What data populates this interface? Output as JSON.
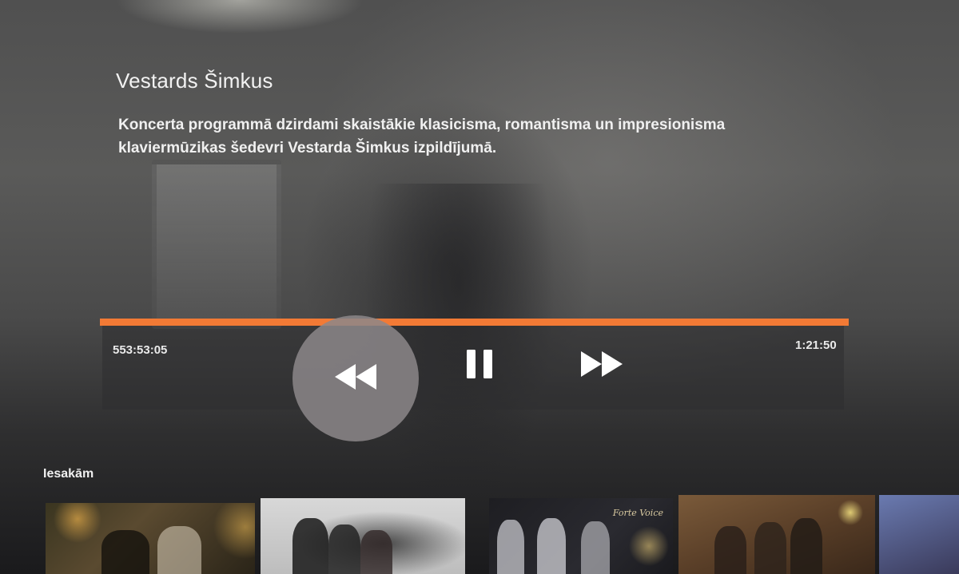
{
  "program": {
    "title": "Vestards Šimkus",
    "description": "Koncerta programmā dzirdami skaistākie klasicisma, romantisma un impresionisma klaviermūzikas šedevri Vestarda Šimkus izpildījumā."
  },
  "player": {
    "elapsed": "553:53:05",
    "total": "1:21:50",
    "progress_fraction": 1.0,
    "accent_color": "#f27a35",
    "controls": {
      "rewind_icon": "rewind-icon",
      "pause_icon": "pause-icon",
      "fast_forward_icon": "fast-forward-icon"
    }
  },
  "recommendations": {
    "label": "Iesakām",
    "items": [
      {
        "id": "rec-1",
        "overlay_text": ""
      },
      {
        "id": "rec-2",
        "overlay_text": ""
      },
      {
        "id": "rec-3",
        "overlay_text": "Forte Voice"
      },
      {
        "id": "rec-4",
        "overlay_text": ""
      },
      {
        "id": "rec-5",
        "overlay_text": ""
      }
    ]
  }
}
